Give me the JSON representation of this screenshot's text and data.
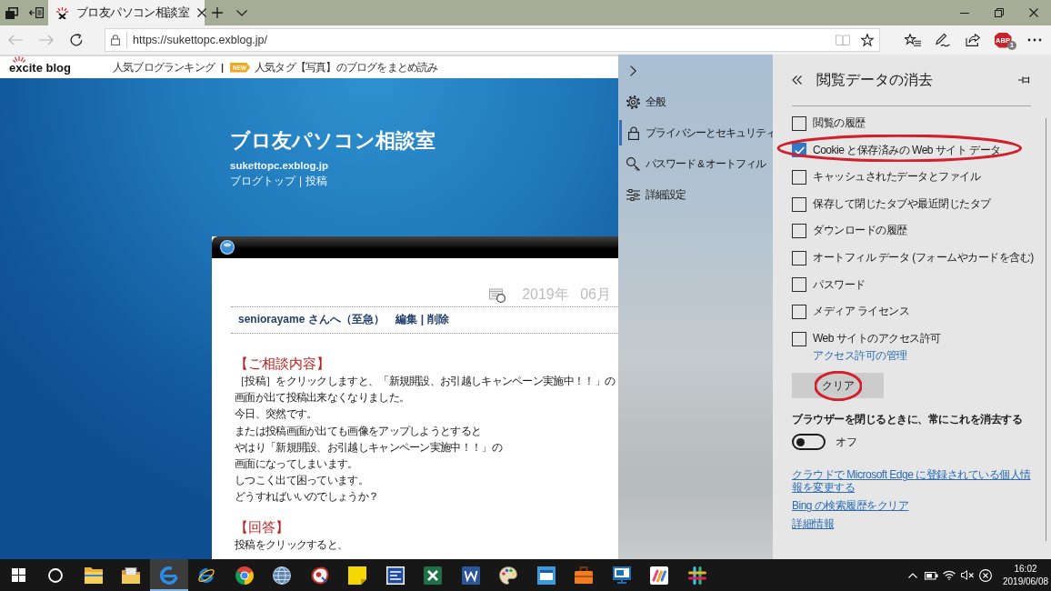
{
  "browser": {
    "tabs": [
      {
        "title": "ブロ友パソコン相談室",
        "selected": true
      }
    ],
    "toolbar": {
      "back": {
        "disabled": true
      },
      "forward": {
        "disabled": true
      },
      "url": "https://sukettopc.exblog.jp/",
      "reading_view": {
        "disabled": true
      },
      "extension": {
        "label": "ABP",
        "count": "1"
      }
    }
  },
  "page": {
    "topbar": {
      "logo": "excite blog",
      "ranking_link": "人気ブログランキング",
      "separator": "|",
      "badge": "NEW",
      "tag_link": "人気タグ【写真】のブログをまとめ読み"
    },
    "header": {
      "title": "ブロ友パソコン相談室",
      "url": "sukettopc.exblog.jp",
      "links": [
        "ブログトップ",
        "投稿"
      ],
      "separator": "|"
    },
    "post": {
      "date": "2019年 06月",
      "title": "seniorayame さんへ（至急）",
      "actions": [
        "編集",
        "削除"
      ],
      "separator": "|",
      "sections": [
        {
          "heading": "【ご相談内容】",
          "lines": [
            "［投稿］をクリックしますと、「新規開設、お引越しキャンペーン実施中！！」の",
            "画面が出て投稿出来なくなりました。",
            "今日、突然です。",
            "または投稿画面が出ても画像をアップしようとすると",
            "やはり「新規開設、お引越しキャンペーン実施中！！」の",
            "画面になってしまいます。",
            "しつこく出て困っています。",
            "どうすればいいのでしょうか？"
          ]
        },
        {
          "heading": "【回答】",
          "lines": [
            "投稿をクリックすると、"
          ]
        }
      ]
    }
  },
  "settings_nav": {
    "items": [
      {
        "label": "全般",
        "selected": false
      },
      {
        "label": "プライバシーとセキュリティ",
        "selected": true
      },
      {
        "label": "パスワード & オートフィル",
        "selected": false
      },
      {
        "label": "詳細設定",
        "selected": false
      }
    ]
  },
  "clear_data": {
    "title": "閲覧データの消去",
    "options": [
      {
        "label": "閲覧の履歴",
        "checked": false,
        "circled": false
      },
      {
        "label": "Cookie と保存済みの Web サイト データ",
        "checked": true,
        "circled": true
      },
      {
        "label": "キャッシュされたデータとファイル",
        "checked": false,
        "circled": false
      },
      {
        "label": "保存して閉じたタブや最近閉じたタブ",
        "checked": false,
        "circled": false
      },
      {
        "label": "ダウンロードの履歴",
        "checked": false,
        "circled": false
      },
      {
        "label": "オートフィル データ (フォームやカードを含む)",
        "checked": false,
        "circled": false
      },
      {
        "label": "パスワード",
        "checked": false,
        "circled": false
      },
      {
        "label": "メディア ライセンス",
        "checked": false,
        "circled": false
      },
      {
        "label": "Web サイトのアクセス許可",
        "checked": false,
        "circled": false,
        "link": "アクセス許可の管理"
      }
    ],
    "clear_button": {
      "label": "クリア",
      "circled": true
    },
    "on_close": {
      "label": "ブラウザーを閉じるときに、常にこれを消去する",
      "toggle": {
        "on": false,
        "label": "オフ"
      }
    },
    "links": [
      "クラウドで Microsoft Edge に登録されている個人情報を変更する",
      "Bing の検索履歴をクリア",
      "詳細情報"
    ]
  },
  "taskbar": {
    "apps": [
      {
        "selected": false
      },
      {
        "selected": false
      },
      {
        "selected": true
      },
      {
        "selected": false
      },
      {
        "selected": false
      },
      {
        "selected": false
      },
      {
        "selected": false
      },
      {
        "selected": false
      },
      {
        "selected": false
      },
      {
        "selected": false
      },
      {
        "selected": false
      },
      {
        "selected": false
      },
      {
        "selected": false
      },
      {
        "selected": false
      },
      {
        "selected": false
      },
      {
        "selected": false
      },
      {
        "selected": false
      }
    ],
    "clock": {
      "time": "16:02",
      "date": "2019/06/08"
    }
  }
}
